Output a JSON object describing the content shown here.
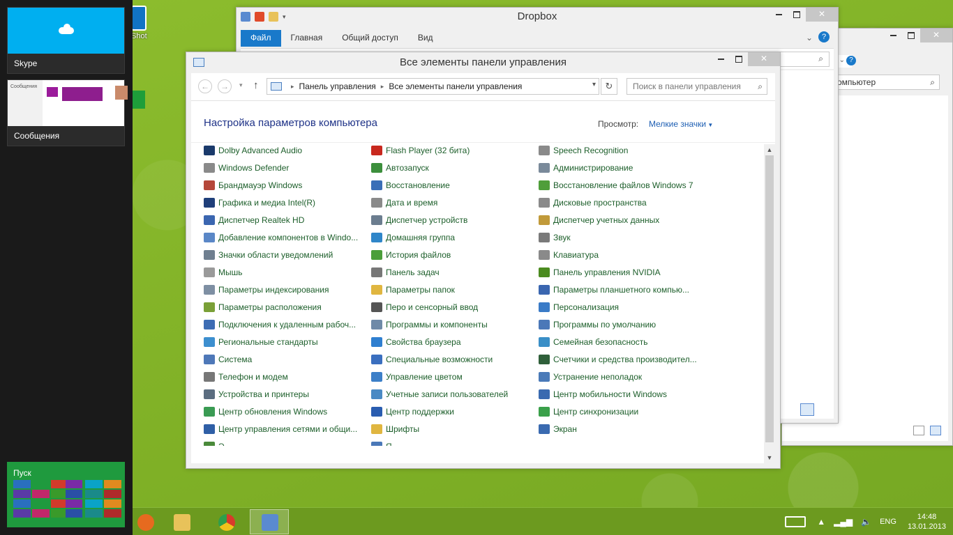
{
  "switcher": {
    "skype_label": "Skype",
    "messages_label": "Сообщения",
    "messages_thumb_text": "Сообщения",
    "start_label": "Пуск"
  },
  "desktop": {
    "icon_label": "Shot"
  },
  "dropbox_window": {
    "title": "Dropbox",
    "tabs": [
      "Файл",
      "Главная",
      "Общий доступ",
      "Вид"
    ]
  },
  "right_window": {
    "address_fragment": "омпьютер"
  },
  "control_panel": {
    "title": "Все элементы панели управления",
    "breadcrumb": [
      "Панель управления",
      "Все элементы панели управления"
    ],
    "search_placeholder": "Поиск в панели управления",
    "heading": "Настройка параметров компьютера",
    "view_label": "Просмотр:",
    "view_value": "Мелкие значки",
    "columns": [
      [
        {
          "label": "Dolby Advanced Audio",
          "icon": "dolby-icon",
          "color": "#1a3a6b"
        },
        {
          "label": "Windows Defender",
          "icon": "defender-icon",
          "color": "#8a8a8a"
        },
        {
          "label": "Брандмауэр Windows",
          "icon": "firewall-icon",
          "color": "#b5473a"
        },
        {
          "label": "Графика и медиа Intel(R)",
          "icon": "intel-icon",
          "color": "#1f3f7a"
        },
        {
          "label": "Диспетчер Realtek HD",
          "icon": "realtek-icon",
          "color": "#3b66b0"
        },
        {
          "label": "Добавление компонентов в Windo...",
          "icon": "add-features-icon",
          "color": "#5a87c7"
        },
        {
          "label": "Значки области уведомлений",
          "icon": "notification-icons-icon",
          "color": "#6f7f90"
        },
        {
          "label": "Мышь",
          "icon": "mouse-icon",
          "color": "#9a9a9a"
        },
        {
          "label": "Параметры индексирования",
          "icon": "indexing-icon",
          "color": "#7e8fa3"
        },
        {
          "label": "Параметры расположения",
          "icon": "location-icon",
          "color": "#7aa037"
        },
        {
          "label": "Подключения к удаленным рабоч...",
          "icon": "remote-desktop-icon",
          "color": "#3d6db4"
        },
        {
          "label": "Региональные стандарты",
          "icon": "region-icon",
          "color": "#3d8fcf"
        },
        {
          "label": "Система",
          "icon": "system-icon",
          "color": "#4e78b8"
        },
        {
          "label": "Телефон и модем",
          "icon": "phone-modem-icon",
          "color": "#777777"
        },
        {
          "label": "Устройства и принтеры",
          "icon": "printers-icon",
          "color": "#5b6d80"
        },
        {
          "label": "Центр обновления Windows",
          "icon": "windows-update-icon",
          "color": "#3a9b53"
        },
        {
          "label": "Центр управления сетями и общи...",
          "icon": "network-center-icon",
          "color": "#2f5fa6"
        },
        {
          "label": "Э...",
          "icon": "energy-icon",
          "color": "#4a8a3a"
        }
      ],
      [
        {
          "label": "Flash Player (32 бита)",
          "icon": "flash-icon",
          "color": "#c8281e"
        },
        {
          "label": "Автозапуск",
          "icon": "autoplay-icon",
          "color": "#3c8f3c"
        },
        {
          "label": "Восстановление",
          "icon": "recovery-icon",
          "color": "#3b6fb7"
        },
        {
          "label": "Дата и время",
          "icon": "datetime-icon",
          "color": "#8a8a8a"
        },
        {
          "label": "Диспетчер устройств",
          "icon": "device-manager-icon",
          "color": "#6b7d8f"
        },
        {
          "label": "Домашняя группа",
          "icon": "homegroup-icon",
          "color": "#2f86c9"
        },
        {
          "label": "История файлов",
          "icon": "file-history-icon",
          "color": "#4b9e3a"
        },
        {
          "label": "Панель задач",
          "icon": "taskbar-icon",
          "color": "#777777"
        },
        {
          "label": "Параметры папок",
          "icon": "folder-options-icon",
          "color": "#e0b640"
        },
        {
          "label": "Перо и сенсорный ввод",
          "icon": "pen-touch-icon",
          "color": "#555555"
        },
        {
          "label": "Программы и компоненты",
          "icon": "programs-icon",
          "color": "#6f8aa8"
        },
        {
          "label": "Свойства браузера",
          "icon": "internet-options-icon",
          "color": "#2f7fd0"
        },
        {
          "label": "Специальные возможности",
          "icon": "accessibility-icon",
          "color": "#3a6fbf"
        },
        {
          "label": "Управление цветом",
          "icon": "color-management-icon",
          "color": "#3c7fc8"
        },
        {
          "label": "Учетные записи пользователей",
          "icon": "user-accounts-icon",
          "color": "#4a8ac4"
        },
        {
          "label": "Центр поддержки",
          "icon": "action-center-icon",
          "color": "#2a5db0"
        },
        {
          "label": "Шрифты",
          "icon": "fonts-icon",
          "color": "#e0b640"
        },
        {
          "label": "Я...",
          "icon": "language-icon",
          "color": "#4a78b8"
        }
      ],
      [
        {
          "label": "Speech Recognition",
          "icon": "speech-icon",
          "color": "#8a8a8a"
        },
        {
          "label": "Администрирование",
          "icon": "admin-tools-icon",
          "color": "#7a8a9a"
        },
        {
          "label": "Восстановление файлов Windows 7",
          "icon": "windows7-backup-icon",
          "color": "#4f9e3a"
        },
        {
          "label": "Дисковые пространства",
          "icon": "storage-spaces-icon",
          "color": "#8a8a8a"
        },
        {
          "label": "Диспетчер учетных данных",
          "icon": "credential-manager-icon",
          "color": "#c19a3a"
        },
        {
          "label": "Звук",
          "icon": "sound-icon",
          "color": "#7a7a7a"
        },
        {
          "label": "Клавиатура",
          "icon": "keyboard-icon",
          "color": "#8a8a8a"
        },
        {
          "label": "Панель управления NVIDIA",
          "icon": "nvidia-icon",
          "color": "#4b8b1f"
        },
        {
          "label": "Параметры планшетного компью...",
          "icon": "tablet-pc-icon",
          "color": "#3a66b0"
        },
        {
          "label": "Персонализация",
          "icon": "personalization-icon",
          "color": "#3a7bc7"
        },
        {
          "label": "Программы по умолчанию",
          "icon": "default-programs-icon",
          "color": "#4b78b8"
        },
        {
          "label": "Семейная безопасность",
          "icon": "family-safety-icon",
          "color": "#3a8fc7"
        },
        {
          "label": "Счетчики и средства производител...",
          "icon": "performance-icon",
          "color": "#2f5f3a"
        },
        {
          "label": "Устранение неполадок",
          "icon": "troubleshooting-icon",
          "color": "#4a7ab8"
        },
        {
          "label": "Центр мобильности Windows",
          "icon": "mobility-center-icon",
          "color": "#3a6ab0"
        },
        {
          "label": "Центр синхронизации",
          "icon": "sync-center-icon",
          "color": "#3aa04a"
        },
        {
          "label": "Экран",
          "icon": "display-icon",
          "color": "#3a6ab0"
        }
      ]
    ]
  },
  "taskbar": {
    "apps": [
      {
        "name": "firefox",
        "color": "#e66a1f"
      },
      {
        "name": "explorer",
        "color": "#e8c25a"
      },
      {
        "name": "chrome",
        "color": "#d93a2b"
      },
      {
        "name": "control-panel",
        "color": "#5a8ad0"
      }
    ],
    "language": "ENG",
    "time": "14:48",
    "date": "13.01.2013"
  }
}
